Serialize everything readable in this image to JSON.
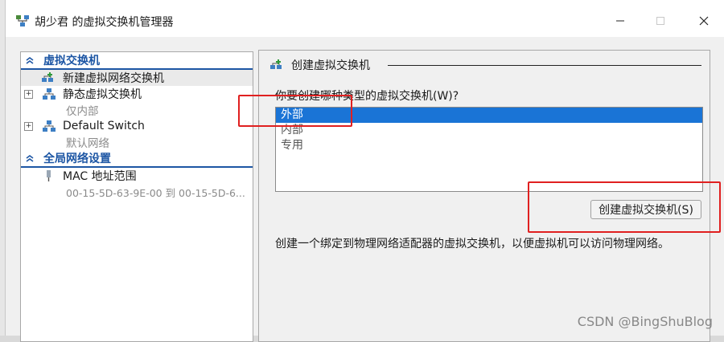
{
  "window": {
    "title": "胡少君 的虚拟交换机管理器"
  },
  "left": {
    "section1": "虚拟交换机",
    "new_switch": "新建虚拟网络交换机",
    "static_switch": "静态虚拟交换机",
    "static_sub": "仅内部",
    "default_switch": "Default Switch",
    "default_sub": "默认网络",
    "section2": "全局网络设置",
    "mac_range": "MAC 地址范围",
    "mac_sub": "00-15-5D-63-9E-00 到 00-15-5D-6..."
  },
  "right": {
    "header": "创建虚拟交换机",
    "question": "你要创建哪种类型的虚拟交换机(W)?",
    "options": [
      "外部",
      "内部",
      "专用"
    ],
    "selected_option": "外部",
    "create_button": "创建虚拟交换机(S)",
    "description": "创建一个绑定到物理网络适配器的虚拟交换机，以便虚拟机可以访问物理网络。"
  },
  "watermark": "CSDN @BingShuBlog",
  "colors": {
    "accent": "#1d56a4",
    "selection": "#1a74d6",
    "annotation": "#e02020"
  }
}
